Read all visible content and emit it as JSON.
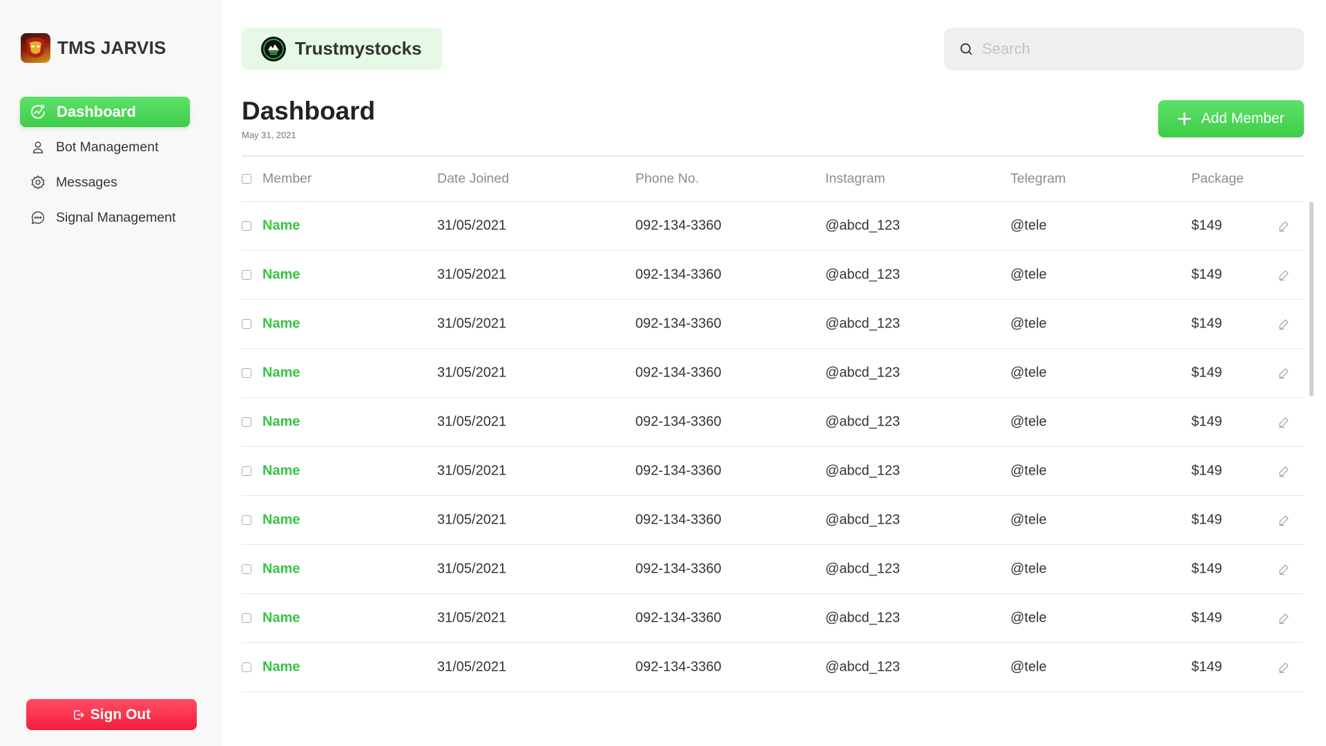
{
  "sidebar": {
    "brand": {
      "title": "TMS JARVIS"
    },
    "nav": [
      {
        "label": "Dashboard",
        "icon": "chart-circle-icon",
        "active": true
      },
      {
        "label": "Bot Management",
        "icon": "user-icon",
        "active": false
      },
      {
        "label": "Messages",
        "icon": "gear-icon",
        "active": false
      },
      {
        "label": "Signal Management",
        "icon": "chat-bubble-icon",
        "active": false
      }
    ],
    "signout_label": "Sign Out"
  },
  "header": {
    "org_name": "Trustmystocks",
    "search": {
      "placeholder": "Search",
      "value": ""
    }
  },
  "main": {
    "title": "Dashboard",
    "date": "May 31, 2021",
    "add_button_label": "Add Member",
    "table": {
      "columns": [
        "Member",
        "Date Joined",
        "Phone No.",
        "Instagram",
        "Telegram",
        "Package"
      ],
      "rows": [
        {
          "member": "Name",
          "date": "31/05/2021",
          "phone": "092-134-3360",
          "instagram": "@abcd_123",
          "telegram": "@tele",
          "package": "$149"
        },
        {
          "member": "Name",
          "date": "31/05/2021",
          "phone": "092-134-3360",
          "instagram": "@abcd_123",
          "telegram": "@tele",
          "package": "$149"
        },
        {
          "member": "Name",
          "date": "31/05/2021",
          "phone": "092-134-3360",
          "instagram": "@abcd_123",
          "telegram": "@tele",
          "package": "$149"
        },
        {
          "member": "Name",
          "date": "31/05/2021",
          "phone": "092-134-3360",
          "instagram": "@abcd_123",
          "telegram": "@tele",
          "package": "$149"
        },
        {
          "member": "Name",
          "date": "31/05/2021",
          "phone": "092-134-3360",
          "instagram": "@abcd_123",
          "telegram": "@tele",
          "package": "$149"
        },
        {
          "member": "Name",
          "date": "31/05/2021",
          "phone": "092-134-3360",
          "instagram": "@abcd_123",
          "telegram": "@tele",
          "package": "$149"
        },
        {
          "member": "Name",
          "date": "31/05/2021",
          "phone": "092-134-3360",
          "instagram": "@abcd_123",
          "telegram": "@tele",
          "package": "$149"
        },
        {
          "member": "Name",
          "date": "31/05/2021",
          "phone": "092-134-3360",
          "instagram": "@abcd_123",
          "telegram": "@tele",
          "package": "$149"
        },
        {
          "member": "Name",
          "date": "31/05/2021",
          "phone": "092-134-3360",
          "instagram": "@abcd_123",
          "telegram": "@tele",
          "package": "$149"
        },
        {
          "member": "Name",
          "date": "31/05/2021",
          "phone": "092-134-3360",
          "instagram": "@abcd_123",
          "telegram": "@tele",
          "package": "$149"
        }
      ]
    }
  },
  "colors": {
    "accent_green": "#3fcc4a",
    "name_green": "#34c63f",
    "danger_red": "#f51e3b",
    "org_pill_bg": "#e6f9e6"
  }
}
